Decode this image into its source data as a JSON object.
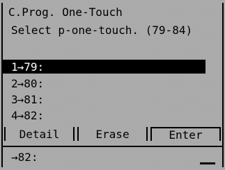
{
  "header": {
    "title": "C.Prog. One-Touch",
    "subtitle": "Select p-one-touch. (79-84)"
  },
  "list": {
    "items": [
      {
        "index": "1",
        "label": "79:",
        "selected": true
      },
      {
        "index": "2",
        "label": "80:",
        "selected": false
      },
      {
        "index": "3",
        "label": "81:",
        "selected": false
      },
      {
        "index": "4",
        "label": "82:",
        "selected": false
      }
    ]
  },
  "softkeys": {
    "detail": "Detail",
    "erase": "Erase",
    "enter": "Enter"
  },
  "input": {
    "value": "82:"
  },
  "colors": {
    "highlight": "#000000",
    "dither": "#cfcfcf"
  }
}
